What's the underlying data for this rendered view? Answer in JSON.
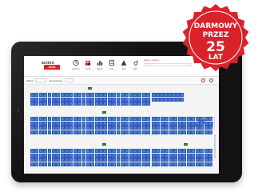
{
  "badge": {
    "line1": "DARMOWY",
    "line2": "PRZEZ",
    "line3": "25",
    "line4": "LAT",
    "color": "#d8232a"
  },
  "app": {
    "logo_top": "action",
    "logo_bottom": "2016",
    "tools": [
      {
        "icon": "clock-icon",
        "label": "Godziny"
      },
      {
        "icon": "people-icon",
        "label": "Osoby"
      },
      {
        "icon": "chart-icon",
        "label": "Raport"
      },
      {
        "icon": "document-icon",
        "label": "Dok."
      },
      {
        "icon": "warning-icon",
        "label": "Alert"
      },
      {
        "icon": "wrench-icon",
        "label": "Narz."
      }
    ],
    "account": "Konto - Admin",
    "subbar_left": "Widok",
    "subbar_mid": "Rezerwacja"
  },
  "colors": {
    "seat": "#4a7bd8",
    "stage": "#3c9a3c",
    "accent": "#d8232a"
  }
}
